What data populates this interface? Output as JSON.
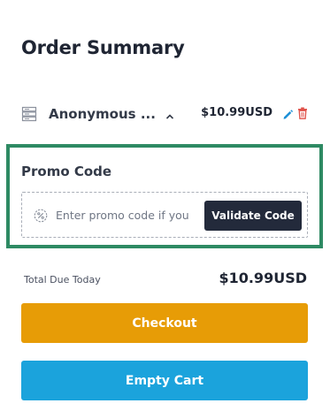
{
  "summary": {
    "title": "Order Summary"
  },
  "cart_item": {
    "name": "Anonymous ...",
    "price": "$10.99USD",
    "icon": "server-icon",
    "toggle_icon": "chevron-up-icon",
    "edit_icon": "pencil-icon",
    "delete_icon": "trash-icon"
  },
  "promo": {
    "label": "Promo Code",
    "placeholder": "Enter promo code if you have one",
    "icon": "discount-icon",
    "button_label": "Validate Code"
  },
  "total": {
    "label": "Total Due Today",
    "value": "$10.99USD"
  },
  "actions": {
    "checkout_label": "Checkout",
    "empty_cart_label": "Empty Cart"
  },
  "colors": {
    "highlight_border": "#2e8a63",
    "checkout": "#e79c06",
    "empty_cart": "#1ba3dc",
    "validate": "#232a3b",
    "edit_icon": "#1b8fd6",
    "delete_icon": "#e0524a"
  }
}
